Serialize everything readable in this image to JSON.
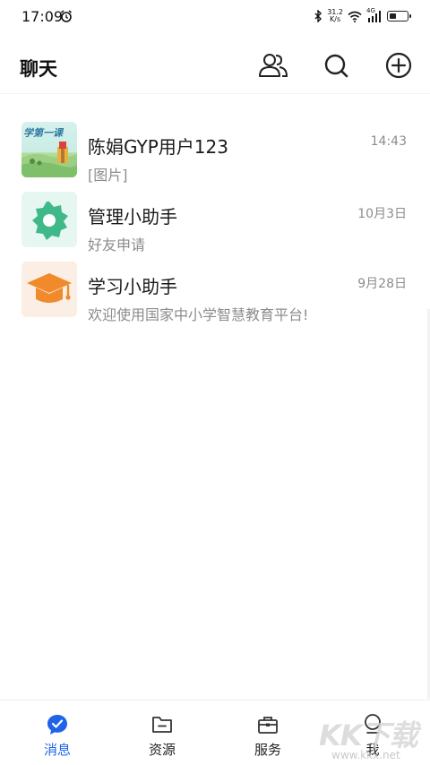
{
  "status_bar": {
    "time": "17:09",
    "net_speed_value": "31.2",
    "net_speed_unit": "K/s",
    "network_type": "4G",
    "battery_level": 0.4,
    "icons": [
      "alarm-icon",
      "bluetooth-icon",
      "wifi-icon",
      "signal-icon",
      "battery-icon"
    ]
  },
  "header": {
    "title": "聊天",
    "actions": [
      "contacts-icon",
      "search-icon",
      "add-icon"
    ]
  },
  "conversations": [
    {
      "name": "陈娟GYP用户123",
      "preview": "[图片]",
      "time": "14:43",
      "avatar_text": "学第一课",
      "avatar": "photo-thumbnail"
    },
    {
      "name": "管理小助手",
      "preview": "好友申请",
      "time": "10月3日",
      "avatar": "gear-icon",
      "avatar_color": "#3fb98a"
    },
    {
      "name": "学习小助手",
      "preview": "欢迎使用国家中小学智慧教育平台!",
      "time": "9月28日",
      "avatar": "graduation-cap-icon",
      "avatar_color": "#f08a2a"
    }
  ],
  "bottom_nav": {
    "items": [
      {
        "label": "消息",
        "icon": "message-icon",
        "active": true
      },
      {
        "label": "资源",
        "icon": "folder-icon",
        "active": false
      },
      {
        "label": "服务",
        "icon": "briefcase-icon",
        "active": false
      },
      {
        "label": "我",
        "icon": "profile-icon",
        "active": false
      }
    ]
  },
  "watermark": {
    "logo": "KK下载",
    "url": "www.kkx.net"
  },
  "colors": {
    "accent": "#1f63e8",
    "text_primary": "#1a1a1a",
    "text_secondary": "#8c8c8c"
  }
}
